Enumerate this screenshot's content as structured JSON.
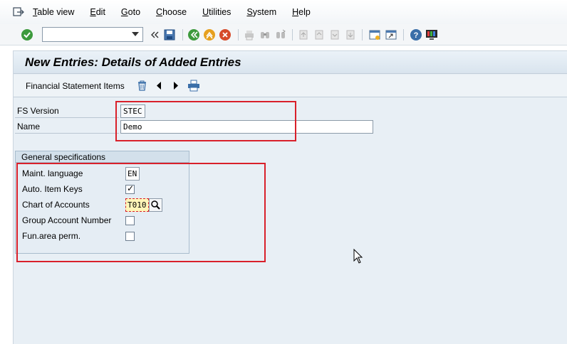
{
  "menu": {
    "items": [
      "Table view",
      "Edit",
      "Goto",
      "Choose",
      "Utilities",
      "System",
      "Help"
    ]
  },
  "toolbar": {
    "command_field_value": ""
  },
  "screen": {
    "title": "New Entries: Details of Added Entries"
  },
  "app_toolbar": {
    "label": "Financial Statement Items"
  },
  "fields": {
    "fs_version": {
      "label": "FS Version",
      "value": "STEC"
    },
    "name": {
      "label": "Name",
      "value": "Demo"
    }
  },
  "general_specs": {
    "title": "General specifications",
    "maint_language": {
      "label": "Maint. language",
      "value": "EN"
    },
    "auto_item_keys": {
      "label": "Auto. Item Keys",
      "checked": true
    },
    "chart_of_accounts": {
      "label": "Chart of Accounts",
      "value": "T010"
    },
    "group_account_number": {
      "label": "Group Account Number",
      "checked": false
    },
    "fun_area_perm": {
      "label": "Fun.area perm.",
      "checked": false
    }
  },
  "colors": {
    "highlight_box": "#d9202a",
    "frame_bg": "#e8eff5",
    "required_field_bg": "#fff6b8"
  }
}
